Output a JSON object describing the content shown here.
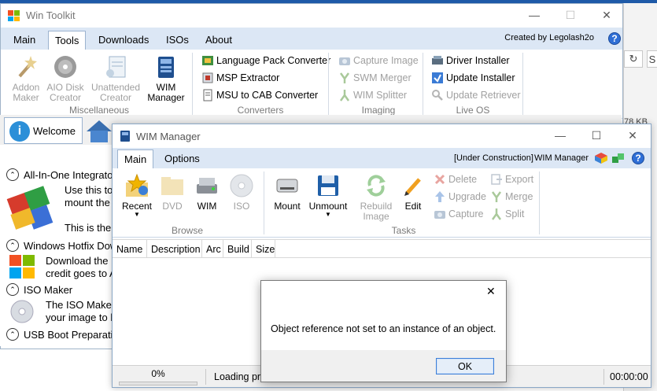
{
  "toolkit": {
    "title": "Win Toolkit",
    "tabs": [
      "Main",
      "Tools",
      "Downloads",
      "ISOs",
      "About"
    ],
    "active_tab": "Tools",
    "created_by": "Created by Legolash2o",
    "help": "?",
    "caption": {
      "min": "—",
      "max": "☐",
      "close": "✕"
    },
    "ribbon": {
      "misc": {
        "label": "Miscellaneous",
        "items": [
          {
            "line1": "Addon",
            "line2": "Maker",
            "enabled": false
          },
          {
            "line1": "AIO Disk",
            "line2": "Creator",
            "enabled": false
          },
          {
            "line1": "Unattended",
            "line2": "Creator",
            "enabled": false
          },
          {
            "line1": "WIM",
            "line2": "Manager",
            "enabled": true
          }
        ]
      },
      "converters": {
        "label": "Converters",
        "items": [
          "Language Pack Converter",
          "MSP Extractor",
          "MSU to CAB Converter"
        ]
      },
      "imaging": {
        "label": "Imaging",
        "items": [
          "Capture Image",
          "SWM Merger",
          "WIM Splitter"
        ]
      },
      "liveos": {
        "label": "Live OS",
        "items": [
          "Driver Installer",
          "Update Installer",
          "Update Retriever"
        ]
      }
    },
    "welcome_tab": "Welcome",
    "sections": [
      {
        "title": "All-In-One Integrator",
        "lines": [
          "Use this to",
          "mount the i",
          "",
          "This is the u"
        ]
      },
      {
        "title": "Windows Hotfix Dow",
        "lines": [
          "Download the la",
          "credit goes to A"
        ]
      },
      {
        "title": "ISO Maker",
        "lines": [
          "The ISO Maker",
          "your image to h"
        ]
      },
      {
        "title": "USB Boot Preparatio",
        "lines": []
      }
    ]
  },
  "background": {
    "kb_text": "78 KB",
    "refresh": "↻",
    "s_btn": "S"
  },
  "wim": {
    "title": "WIM Manager",
    "tabs": [
      "Main",
      "Options"
    ],
    "active_tab": "Main",
    "under_construction": "[Under Construction]",
    "app_name": "WIM Manager",
    "help": "?",
    "caption": {
      "min": "—",
      "max": "☐",
      "close": "✕"
    },
    "browse": {
      "label": "Browse",
      "items": [
        {
          "label": "Recent",
          "enabled": true,
          "dropdown": true
        },
        {
          "label": "DVD",
          "enabled": false
        },
        {
          "label": "WIM",
          "enabled": true
        },
        {
          "label": "ISO",
          "enabled": false
        }
      ]
    },
    "tasks": {
      "label": "Tasks",
      "big": [
        {
          "label": "Mount",
          "enabled": true
        },
        {
          "label": "Unmount",
          "enabled": true,
          "dropdown": true
        },
        {
          "line1": "Rebuild",
          "line2": "Image",
          "enabled": false
        },
        {
          "label": "Edit",
          "enabled": true
        }
      ],
      "small_col1": [
        "Delete",
        "Upgrade",
        "Capture"
      ],
      "small_col2": [
        "Export",
        "Merge",
        "Split"
      ]
    },
    "columns": [
      "Name",
      "Description",
      "Arc",
      "Build",
      "Size"
    ],
    "status": {
      "progress": "0%",
      "progress_value": 0,
      "loading": "Loading pr",
      "time": "00:00:00"
    }
  },
  "dialog": {
    "message": "Object reference not set to an instance of an object.",
    "ok": "OK",
    "close": "✕"
  },
  "colors": {
    "accent": "#1e5aa8",
    "tab_bar": "#dce7f5",
    "help": "#2f6fd6"
  }
}
